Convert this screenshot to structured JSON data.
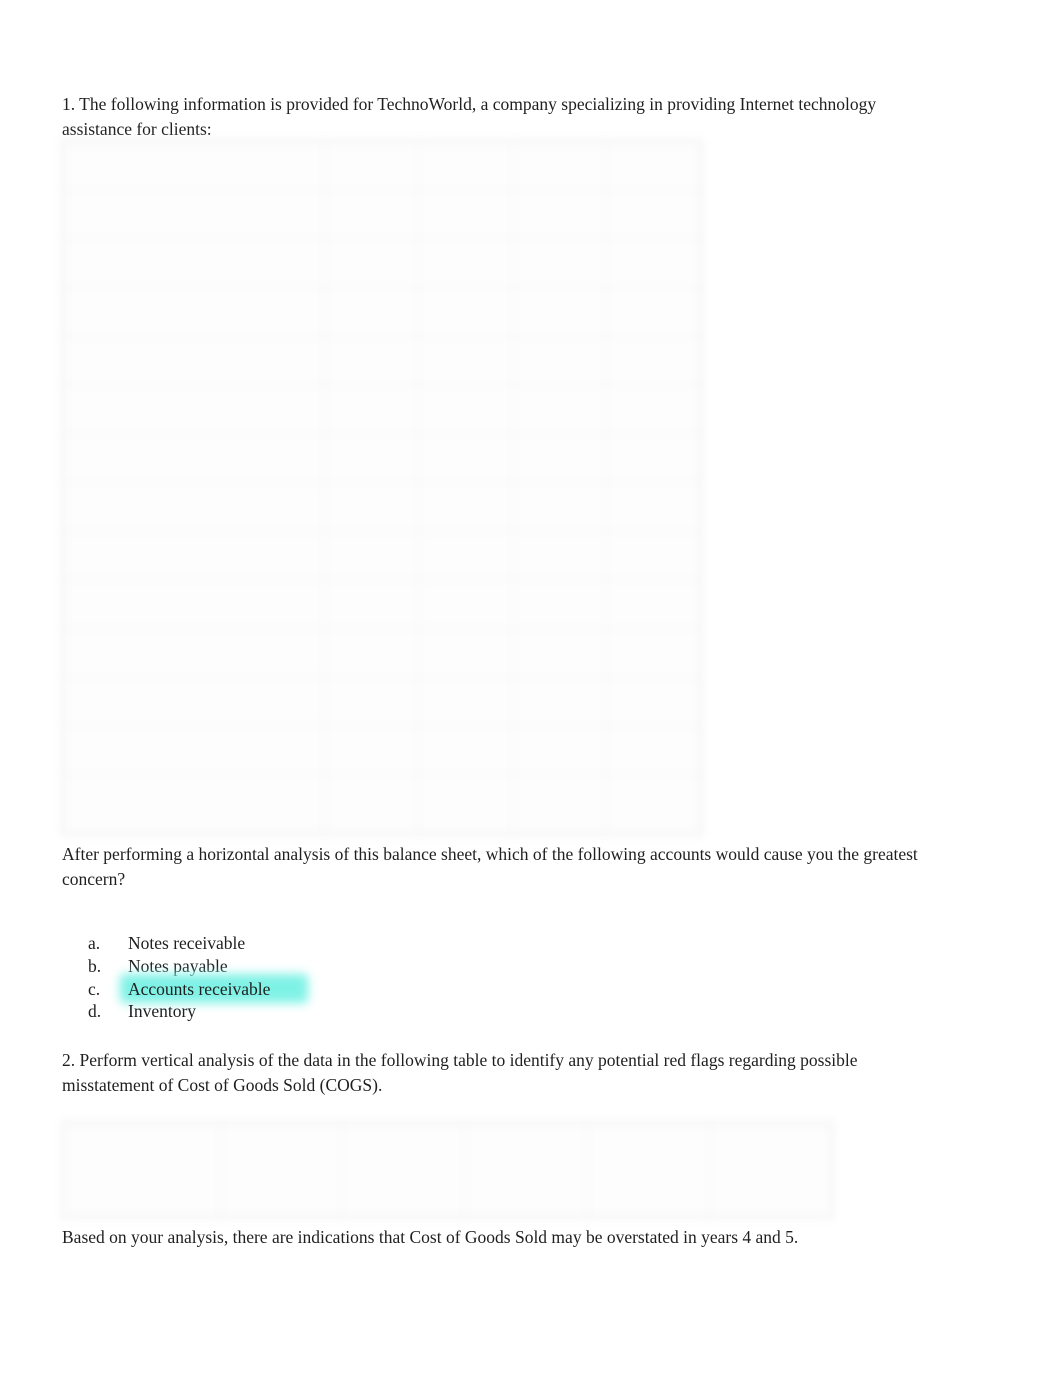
{
  "document": {
    "background_color": "#ffffff",
    "text_color": "#1f1f1f"
  },
  "question1": {
    "intro": "1. The following information is provided for TechnoWorld, a company specializing in providing Internet technology assistance for clients:",
    "prompt": "After performing a horizontal analysis of this balance sheet, which of the following accounts would cause you the greatest concern?",
    "highlight_color": "#7ff2e6",
    "options": [
      {
        "letter": "a.",
        "label": "Notes receivable",
        "highlighted": false
      },
      {
        "letter": "b.",
        "label": "Notes payable",
        "highlighted": false
      },
      {
        "letter": "c.",
        "label": "Accounts receivable",
        "highlighted": true
      },
      {
        "letter": "d.",
        "label": "Inventory",
        "highlighted": false
      }
    ]
  },
  "balance_sheet_table": {
    "note": "content is visually blurred/redacted in the source image",
    "columns": [
      "",
      "",
      "",
      "",
      ""
    ],
    "rows": [
      {
        "label": "",
        "values": [
          "",
          "",
          "",
          ""
        ],
        "header": true
      },
      {
        "label": "",
        "values": [
          "",
          "",
          "",
          ""
        ]
      },
      {
        "label": "",
        "values": [
          "",
          "",
          "",
          ""
        ]
      },
      {
        "label": "",
        "values": [
          "",
          "",
          "",
          ""
        ]
      },
      {
        "label": "",
        "values": [
          "",
          "",
          "",
          ""
        ]
      },
      {
        "label": "",
        "values": [
          "",
          "",
          "",
          ""
        ]
      },
      {
        "label": "",
        "values": [
          "",
          "",
          "",
          ""
        ]
      },
      {
        "label": "",
        "values": [
          "",
          "",
          "",
          ""
        ]
      },
      {
        "label": "",
        "values": [
          "",
          "",
          "",
          ""
        ]
      },
      {
        "label": "",
        "values": [
          "",
          "",
          "",
          ""
        ]
      },
      {
        "label": "",
        "values": [
          "",
          "",
          "",
          ""
        ]
      },
      {
        "label": "",
        "values": [
          "",
          "",
          "",
          ""
        ]
      },
      {
        "label": "",
        "values": [
          "",
          "",
          "",
          ""
        ]
      },
      {
        "label": "",
        "values": [
          "",
          "",
          "",
          ""
        ],
        "two_line": true
      }
    ]
  },
  "question2": {
    "intro": "2. Perform vertical analysis of the data in the following table to identify any potential red flags regarding possible misstatement of Cost of Goods Sold (COGS).",
    "conclusion": "Based on your analysis, there are indications that Cost of Goods Sold may be overstated in years 4 and 5."
  },
  "cogs_table": {
    "note": "content is visually blurred/redacted in the source image",
    "caption": "",
    "rows": [
      {
        "label": "",
        "values": [
          "",
          "",
          "",
          "",
          ""
        ]
      }
    ]
  }
}
